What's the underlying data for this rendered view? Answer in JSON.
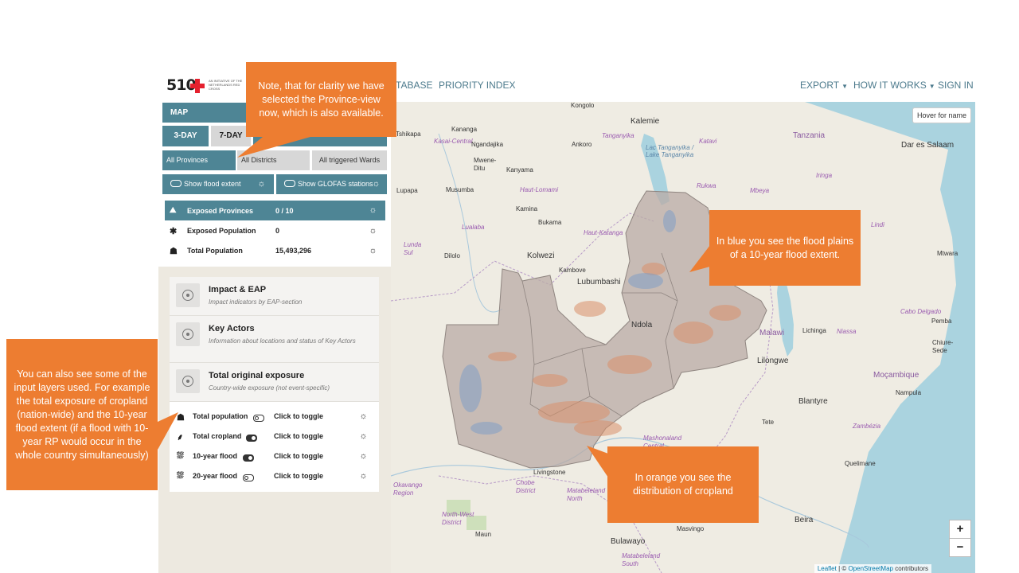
{
  "logo": {
    "mark": "510",
    "tagline": "AN INITIATIVE OF THE NETHERLANDS RED CROSS"
  },
  "nav": {
    "left_links": [
      "TABASE",
      "PRIORITY INDEX"
    ],
    "right_links": [
      "EXPORT",
      "HOW IT WORKS",
      "SIGN IN"
    ]
  },
  "panel": {
    "header": "MAP",
    "tabs": [
      "3-DAY",
      "7-DAY"
    ],
    "geo_buttons": [
      "All Provinces",
      "All Districts",
      "All triggered Wards"
    ],
    "toggles": [
      "Show flood extent",
      "Show GLOFAS stations"
    ],
    "stats": {
      "header_label": "Exposed Provinces",
      "header_value": "0 / 10",
      "rows": [
        {
          "label": "Exposed Population",
          "value": "0"
        },
        {
          "label": "Total Population",
          "value": "15,493,296"
        }
      ]
    },
    "cards": [
      {
        "title": "Impact & EAP",
        "subtitle": "Impact indicators by EAP-section"
      },
      {
        "title": "Key Actors",
        "subtitle": "Information about locations and status of Key Actors"
      },
      {
        "title": "Total original exposure",
        "subtitle": "Country-wide exposure (not event-specific)"
      }
    ],
    "layers": [
      {
        "label": "Total population",
        "action": "Click to toggle",
        "state": "off"
      },
      {
        "label": "Total cropland",
        "action": "Click to toggle",
        "state": "on"
      },
      {
        "label": "10-year flood",
        "action": "Click to toggle",
        "state": "on"
      },
      {
        "label": "20-year flood",
        "action": "Click to toggle",
        "state": "off"
      }
    ]
  },
  "map": {
    "hover_hint": "Hover for name",
    "zoom_in": "+",
    "zoom_out": "−",
    "attribution_leaflet": "Leaflet",
    "attribution_sep": " | © ",
    "attribution_osm": "OpenStreetMap",
    "attribution_tail": " contributors",
    "labels": [
      {
        "text": "Kongolo",
        "cls": ""
      },
      {
        "text": "Kalemie",
        "cls": "big"
      },
      {
        "text": "Tshikapa",
        "cls": ""
      },
      {
        "text": "Kananga",
        "cls": ""
      },
      {
        "text": "Kasai-Central",
        "cls": "region"
      },
      {
        "text": "Tanganyika",
        "cls": "region"
      },
      {
        "text": "Tanzania",
        "cls": "country"
      },
      {
        "text": "Dar es Salaam",
        "cls": ""
      },
      {
        "text": "Ngandajika",
        "cls": ""
      },
      {
        "text": "Ankoro",
        "cls": ""
      },
      {
        "text": "Katavi",
        "cls": "region"
      },
      {
        "text": "Mwene-Ditu",
        "cls": ""
      },
      {
        "text": "Kanyama",
        "cls": ""
      },
      {
        "text": "Lac Tanganyika / Lake Tanganyika",
        "cls": "water"
      },
      {
        "text": "Musumba",
        "cls": ""
      },
      {
        "text": "Haut-Lomami",
        "cls": "region"
      },
      {
        "text": "Rukwa",
        "cls": "region"
      },
      {
        "text": "Mbeya",
        "cls": "region"
      },
      {
        "text": "Iringa",
        "cls": "region"
      },
      {
        "text": "Lupapa",
        "cls": ""
      },
      {
        "text": "Kamina",
        "cls": ""
      },
      {
        "text": "Bukama",
        "cls": ""
      },
      {
        "text": "Lualaba",
        "cls": "region"
      },
      {
        "text": "Lindi",
        "cls": "region"
      },
      {
        "text": "Lunda Sul",
        "cls": "region"
      },
      {
        "text": "Dilolo",
        "cls": ""
      },
      {
        "text": "Kolwezi",
        "cls": "big"
      },
      {
        "text": "Haut-Katanga",
        "cls": "region"
      },
      {
        "text": "Mtwara",
        "cls": ""
      },
      {
        "text": "Kambove",
        "cls": ""
      },
      {
        "text": "Lubumbashi",
        "cls": "big"
      },
      {
        "text": "Cabo Delgado",
        "cls": "region"
      },
      {
        "text": "Pemba",
        "cls": ""
      },
      {
        "text": "Ndola",
        "cls": "big"
      },
      {
        "text": "Malawi",
        "cls": "country"
      },
      {
        "text": "Lichinga",
        "cls": ""
      },
      {
        "text": "Niassa",
        "cls": "region"
      },
      {
        "text": "Chiure-Sede",
        "cls": ""
      },
      {
        "text": "Lilongwe",
        "cls": "big"
      },
      {
        "text": "Moçambique",
        "cls": "country"
      },
      {
        "text": "Nampula",
        "cls": ""
      },
      {
        "text": "Blantyre",
        "cls": "big"
      },
      {
        "text": "Tete",
        "cls": ""
      },
      {
        "text": "Zambézia",
        "cls": "region"
      },
      {
        "text": "Mashonaland Central",
        "cls": "region"
      },
      {
        "text": "Quelimane",
        "cls": ""
      },
      {
        "text": "Chobe District",
        "cls": "region"
      },
      {
        "text": "Livingstone",
        "cls": ""
      },
      {
        "text": "Matabeleland North",
        "cls": "region"
      },
      {
        "text": "Okavango Region",
        "cls": "region"
      },
      {
        "text": "North-West District",
        "cls": "region"
      },
      {
        "text": "Beira",
        "cls": "big"
      },
      {
        "text": "Maun",
        "cls": ""
      },
      {
        "text": "Masvingo",
        "cls": ""
      },
      {
        "text": "Bulawayo",
        "cls": "big"
      },
      {
        "text": "Matabeleland South",
        "cls": "region"
      },
      {
        "text": "Mwene-Ditu",
        "cls": "hidden"
      }
    ]
  },
  "callouts": {
    "top": "Note, that for clarity we have selected the Province-view now, which is also available.",
    "right": "In blue you see the flood plains of a 10-year flood extent.",
    "left": "You can also see some of the input layers used. For example the total exposure of cropland (nation-wide) and the 10-year flood extent (if a flood with 10-year RP would occur in the whole country simultaneously)",
    "bottom": "In orange you see the distribution of cropland"
  }
}
